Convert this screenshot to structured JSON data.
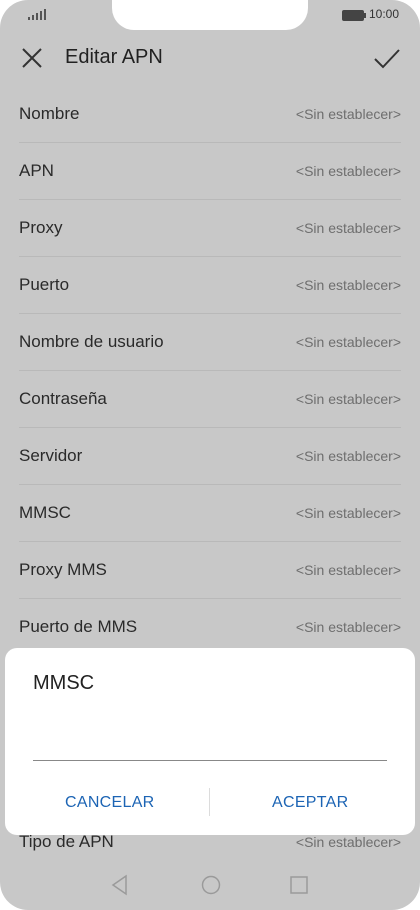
{
  "status": {
    "time": "10:00"
  },
  "appbar": {
    "title": "Editar APN",
    "close_icon": "close-icon",
    "confirm_icon": "check-icon"
  },
  "fields": [
    {
      "label": "Nombre",
      "value": "<Sin establecer>"
    },
    {
      "label": "APN",
      "value": "<Sin establecer>"
    },
    {
      "label": "Proxy",
      "value": "<Sin establecer>"
    },
    {
      "label": "Puerto",
      "value": "<Sin establecer>"
    },
    {
      "label": "Nombre de usuario",
      "value": "<Sin establecer>"
    },
    {
      "label": "Contraseña",
      "value": "<Sin establecer>"
    },
    {
      "label": "Servidor",
      "value": "<Sin establecer>"
    },
    {
      "label": "MMSC",
      "value": "<Sin establecer>"
    },
    {
      "label": "Proxy MMS",
      "value": "<Sin establecer>"
    },
    {
      "label": "Puerto de MMS",
      "value": "<Sin establecer>"
    }
  ],
  "last_field": {
    "label": "Tipo de APN",
    "value": "<Sin establecer>"
  },
  "dialog": {
    "title": "MMSC",
    "input_value": "",
    "cancel_label": "CANCELAR",
    "accept_label": "ACEPTAR"
  },
  "colors": {
    "accent": "#1c64b4",
    "scrim_background": "#c8c8c8"
  }
}
